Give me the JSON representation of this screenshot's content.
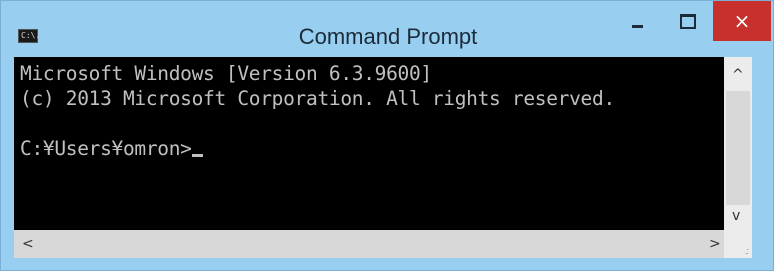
{
  "window": {
    "title": "Command Prompt",
    "icon_label": "C:\\."
  },
  "controls": {
    "close_symbol": "×"
  },
  "console": {
    "lines": [
      "Microsoft Windows [Version 6.3.9600]",
      "(c) 2013 Microsoft Corporation. All rights reserved.",
      "",
      "C:¥Users¥omron>"
    ]
  },
  "scroll": {
    "up": "^",
    "down": "v",
    "left": "<",
    "right": ">"
  },
  "colors": {
    "titlebar": "#98ceef",
    "close": "#c7302b",
    "console_bg": "#000000",
    "console_fg": "#c0c0c0"
  }
}
